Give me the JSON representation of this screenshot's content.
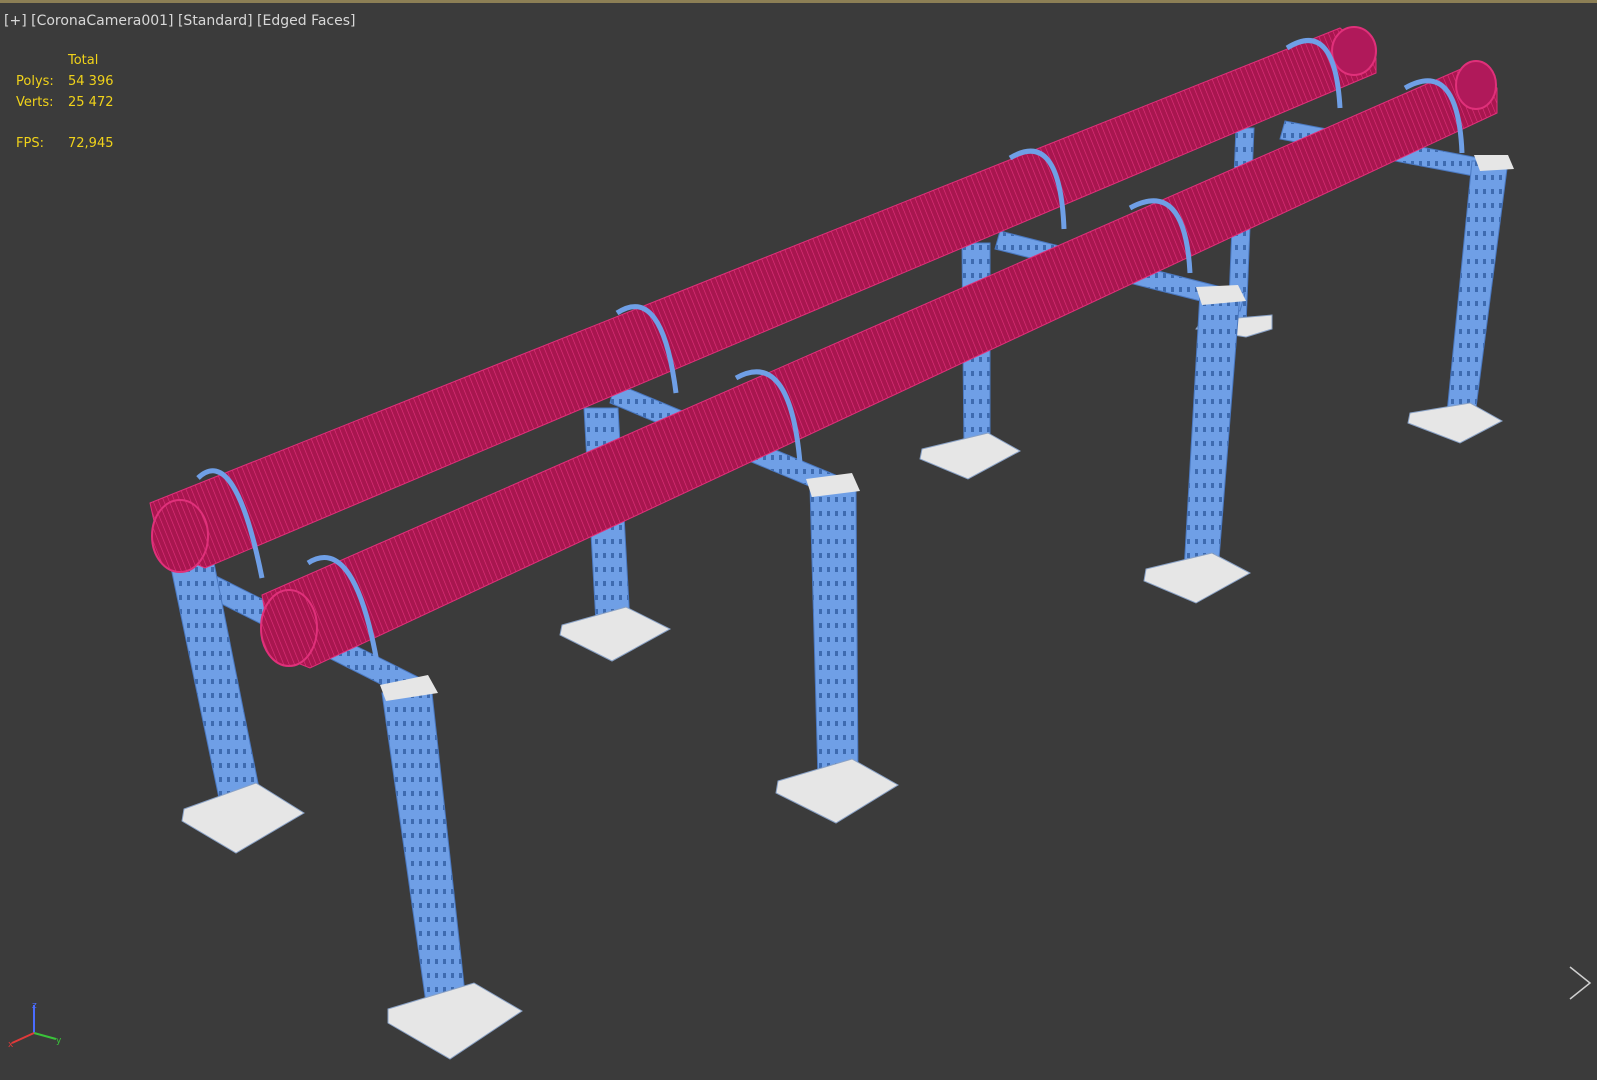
{
  "viewport": {
    "label_parts": [
      "[+]",
      "[CoronaCamera001]",
      "[Standard]",
      "[Edged Faces]"
    ]
  },
  "stats": {
    "header": "Total",
    "polys_label": "Polys:",
    "polys_value": "54 396",
    "verts_label": "Verts:",
    "verts_value": "25 472",
    "fps_label": "FPS:",
    "fps_value": "72,945"
  },
  "axis": {
    "z_label": "z",
    "y_label": "y",
    "x_label": "x"
  },
  "colors": {
    "background": "#3b3b3b",
    "pipe": "#b0195a",
    "pipe_edge": "#e0307a",
    "steel": "#6f9fe6",
    "steel_dark": "#4a78c0",
    "plate": "#e6e6e6",
    "stats_text": "#f0d21a",
    "label_text": "#d8d8d8"
  },
  "scene": {
    "objects": [
      "pipe-rack-frame",
      "pipe-1",
      "pipe-2",
      "u-bolt-clamps",
      "base-plates"
    ]
  }
}
